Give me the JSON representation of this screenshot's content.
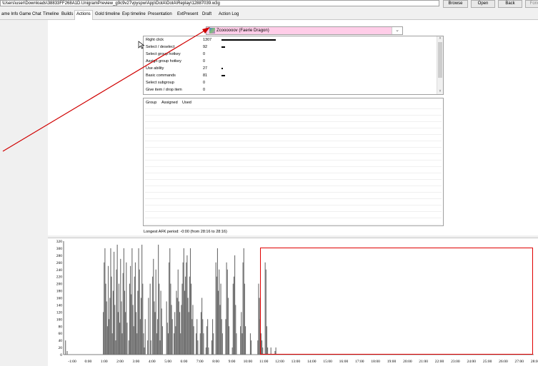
{
  "path": "\\Users\\user\\Downloads\\38833FF268A1D.UnigramPreview_g9c9v27vpyspw!App\\DotA\\DotA\\Replay\\12887039.w3g",
  "top_buttons": {
    "browse": "Browse",
    "open": "Open",
    "back": "Back",
    "forward": "Forwa"
  },
  "tabs": [
    "ame Info",
    "Game Chat",
    "Timeline",
    "Builds",
    "Actions",
    "Gold timeline",
    "Exp timeline",
    "Presentation",
    "ExtPresent",
    "Draft",
    "Action Log"
  ],
  "active_tab": "Actions",
  "player": {
    "name": "Zcoooooov (Faerie Dragon)",
    "color": "#ffcde8"
  },
  "actions": [
    {
      "label": "Right click",
      "value": "1307",
      "fraction": 1.0
    },
    {
      "label": "Select / deselect",
      "value": "92",
      "fraction": 0.07
    },
    {
      "label": "Select group hotkey",
      "value": "0",
      "fraction": 0
    },
    {
      "label": "Assign group hotkey",
      "value": "0",
      "fraction": 0
    },
    {
      "label": "Use ability",
      "value": "27",
      "fraction": 0.02
    },
    {
      "label": "Basic commands",
      "value": "81",
      "fraction": 0.06
    },
    {
      "label": "Select subgroup",
      "value": "0",
      "fraction": 0
    },
    {
      "label": "Give item / drop item",
      "value": "0",
      "fraction": 0
    }
  ],
  "groups_headers": [
    "Group",
    "Assigned",
    "Used"
  ],
  "afk_text": "Longest AFK period: -0:00 (from 28:16 to 28:16)",
  "chart_data": {
    "type": "bar",
    "ylim": [
      0,
      320
    ],
    "y_ticks": [
      "0",
      "20",
      "40",
      "60",
      "80",
      "100",
      "120",
      "140",
      "160",
      "180",
      "200",
      "220",
      "240",
      "260",
      "280",
      "300",
      "320"
    ],
    "x_ticks": [
      "-1:00",
      "0:00",
      "1:00",
      "2:00",
      "3:00",
      "4:00",
      "5:00",
      "6:00",
      "7:00",
      "8:00",
      "9:00",
      "10:00",
      "11:00",
      "12:00",
      "13:00",
      "14:00",
      "15:00",
      "16:00",
      "17:00",
      "18:00",
      "19:00",
      "20:00",
      "21:00",
      "22:00",
      "23:00",
      "24:00",
      "25:00",
      "26:00",
      "27:00",
      "28:00"
    ],
    "values": [
      0,
      40,
      0,
      10,
      0,
      0,
      0,
      0,
      0,
      0,
      0,
      0,
      0,
      0,
      0,
      0,
      0,
      0,
      0,
      0,
      0,
      0,
      0,
      0,
      0,
      0,
      0,
      0,
      0,
      0,
      0,
      0,
      0,
      0,
      0,
      0,
      0,
      0,
      0,
      0,
      0,
      0,
      0,
      0,
      0,
      0,
      0,
      120,
      260,
      300,
      200,
      150,
      80,
      250,
      100,
      160,
      300,
      220,
      60,
      180,
      290,
      140,
      40,
      240,
      310,
      120,
      200,
      90,
      270,
      150,
      60,
      230,
      300,
      180,
      120,
      260,
      90,
      0,
      40,
      200,
      250,
      170,
      300,
      140,
      80,
      220,
      260,
      120,
      60,
      180,
      300,
      240,
      100,
      160,
      310,
      200,
      60,
      20,
      100,
      0,
      0,
      40,
      160,
      0,
      200,
      40,
      0,
      220,
      270,
      150,
      120,
      240,
      60,
      100,
      310,
      200,
      40,
      180,
      130,
      80,
      0,
      0,
      0,
      0,
      150,
      90,
      60,
      260,
      300,
      200,
      140,
      100,
      0,
      60,
      120,
      80,
      180,
      160,
      240,
      150,
      120,
      60,
      140,
      200,
      260,
      300,
      180,
      220,
      260,
      280,
      160,
      120,
      220,
      300,
      200,
      100,
      140,
      80,
      0,
      0,
      60,
      100,
      40,
      0,
      0,
      60,
      120,
      160,
      100,
      60,
      0,
      0,
      20,
      80,
      100,
      20,
      0,
      0,
      0,
      40,
      100,
      60,
      0,
      0,
      260,
      220,
      300,
      180,
      240,
      140,
      200,
      100,
      60,
      0,
      0,
      0,
      100,
      260,
      240,
      160,
      80,
      0,
      0,
      0,
      20,
      200,
      220,
      280,
      140,
      60,
      0,
      0,
      0,
      0,
      80,
      120,
      60,
      260,
      300,
      200,
      80,
      0,
      0,
      0,
      0,
      0,
      60,
      40,
      0,
      0,
      0,
      0,
      0,
      0,
      0,
      40,
      200,
      160,
      100,
      60,
      40,
      20,
      0,
      0,
      260,
      240,
      80,
      20,
      0,
      0,
      0,
      20,
      0,
      0,
      0,
      0,
      10,
      20
    ]
  }
}
